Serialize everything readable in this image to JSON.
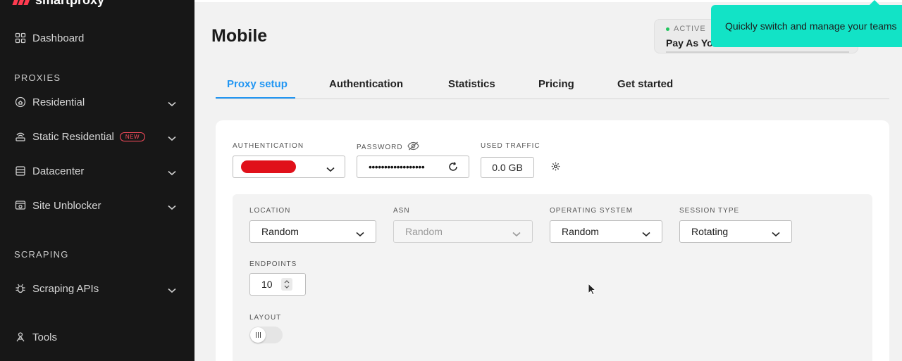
{
  "brand": {
    "name": "smartproxy"
  },
  "sidebar": {
    "top_item": {
      "label": "Dashboard",
      "icon": "dashboard-icon"
    },
    "sections": [
      {
        "title": "PROXIES"
      },
      {
        "title": "SCRAPING"
      }
    ],
    "items": [
      {
        "label": "Residential",
        "icon": "residential-icon"
      },
      {
        "label": "Static Residential",
        "icon": "static-residential-icon",
        "badge": "NEW"
      },
      {
        "label": "Datacenter",
        "icon": "datacenter-icon"
      },
      {
        "label": "Site Unblocker",
        "icon": "site-unblocker-icon"
      },
      {
        "label": "Scraping APIs",
        "icon": "bug-icon"
      },
      {
        "label": "Tools",
        "icon": "tools-icon"
      }
    ]
  },
  "page": {
    "title": "Mobile"
  },
  "plan": {
    "status": "ACTIVE",
    "name": "Pay As You"
  },
  "tooltip": {
    "text": "Quickly switch and manage your teams"
  },
  "tabs": [
    {
      "label": "Proxy setup",
      "active": true
    },
    {
      "label": "Authentication"
    },
    {
      "label": "Statistics"
    },
    {
      "label": "Pricing"
    },
    {
      "label": "Get started"
    }
  ],
  "setup": {
    "authentication_label": "AUTHENTICATION",
    "password_label": "PASSWORD",
    "password_value": "••••••••••••••••••",
    "used_traffic_label": "USED TRAFFIC",
    "used_traffic_value": "0.0 GB",
    "location_label": "LOCATION",
    "location_value": "Random",
    "asn_label": "ASN",
    "asn_value": "Random",
    "os_label": "OPERATING SYSTEM",
    "os_value": "Random",
    "session_label": "SESSION TYPE",
    "session_value": "Rotating",
    "endpoints_label": "ENDPOINTS",
    "endpoints_value": "10",
    "layout_label": "LAYOUT"
  },
  "colors": {
    "accent": "#2196f3",
    "tooltip": "#12e3c6",
    "brand": "#ff3b50",
    "sidebar": "#171717"
  }
}
